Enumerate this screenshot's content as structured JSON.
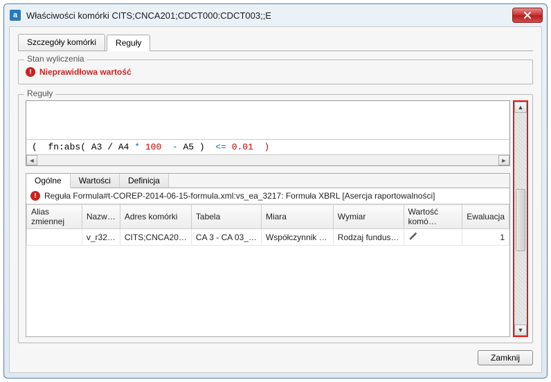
{
  "window": {
    "title": "Właściwości komórki CITS;CNCA201;CDCT000:CDCT003;;E",
    "appicon_letter": "a"
  },
  "tabs": {
    "cell_details": "Szczegóły komórki",
    "rules": "Reguły"
  },
  "status": {
    "legend": "Stan wyliczenia",
    "message": "Nieprawidłowa wartość"
  },
  "rules_section": {
    "legend": "Reguły",
    "formula": {
      "open": "(  fn:abs( A3 / A4 ",
      "times": "*",
      "hundred": " 100  ",
      "minus": "-",
      "a5": " A5 )  ",
      "le": "<=",
      "tail": " 0.01  )"
    },
    "inner_tabs": {
      "general": "Ogólne",
      "values": "Wartości",
      "definition": "Definicja"
    },
    "rule_title": "Reguła Formula#t-COREP-2014-06-15-formula.xml:vs_ea_3217: Formuła XBRL [Asercja raportowalności]",
    "columns": {
      "alias": "Alias zmiennej",
      "name": "Nazw…",
      "cell_addr": "Adres komórki",
      "table": "Tabela",
      "measure": "Miara",
      "dimension": "Wymiar",
      "cell_value": "Wartość komó…",
      "evaluation": "Ewaluacja"
    },
    "row1": {
      "alias": "",
      "name": "v_r32…",
      "cell_addr": "CITS;CNCA20…",
      "table": "CA 3 - CA 03_…",
      "measure": "Współczynnik …",
      "dimension": "Rodzaj fundus…",
      "cell_value": "",
      "evaluation": "1"
    }
  },
  "footer": {
    "close": "Zamknij"
  }
}
